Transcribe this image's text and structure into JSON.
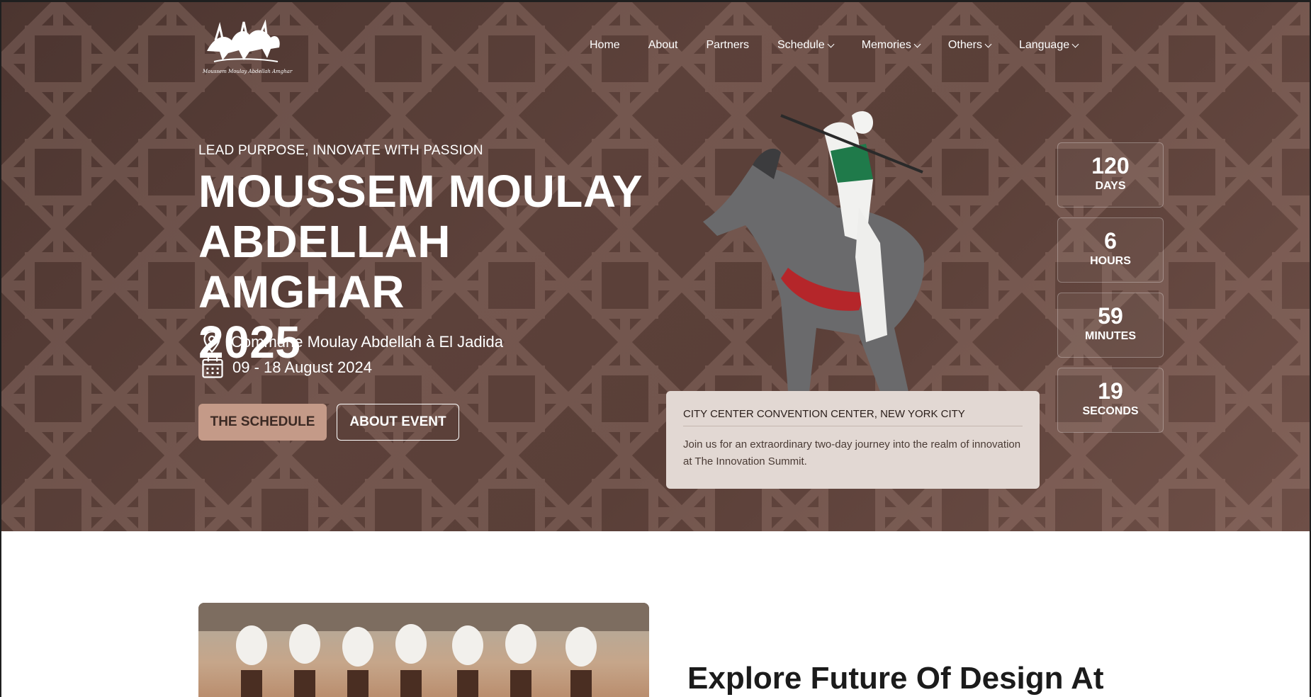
{
  "brand": {
    "logo_caption": "Moussem Moulay Abdellah Amghar"
  },
  "nav": {
    "items": [
      {
        "label": "Home",
        "has_dropdown": false
      },
      {
        "label": "About",
        "has_dropdown": false
      },
      {
        "label": "Partners",
        "has_dropdown": false
      },
      {
        "label": "Schedule",
        "has_dropdown": true
      },
      {
        "label": "Memories",
        "has_dropdown": true
      },
      {
        "label": "Others",
        "has_dropdown": true
      },
      {
        "label": "Language",
        "has_dropdown": true
      }
    ]
  },
  "hero": {
    "tagline": "LEAD PURPOSE, INNOVATE WITH PASSION",
    "title_line1": "MOUSSEM MOULAY",
    "title_line2": "ABDELLAH AMGHAR",
    "title_line3": "2025",
    "location": "Commune Moulay Abdellah à El Jadida",
    "date": "09 - 18 August 2024",
    "primary_button": "THE SCHEDULE",
    "secondary_button": "ABOUT EVENT"
  },
  "venue": {
    "title": "CITY CENTER CONVENTION CENTER, NEW YORK CITY",
    "description": "Join us for an extraordinary two-day journey into the realm of innovation at The Innovation Summit."
  },
  "countdown": {
    "days": {
      "value": "120",
      "label": "DAYS"
    },
    "hours": {
      "value": "6",
      "label": "HOURS"
    },
    "minutes": {
      "value": "59",
      "label": "MINUTES"
    },
    "seconds": {
      "value": "19",
      "label": "SECONDS"
    }
  },
  "about": {
    "heading": "Explore Future Of Design At"
  },
  "colors": {
    "hero_bg": "#5a3f38",
    "primary_button_bg": "#c49a88",
    "venue_card_bg": "#e2d8d3"
  }
}
